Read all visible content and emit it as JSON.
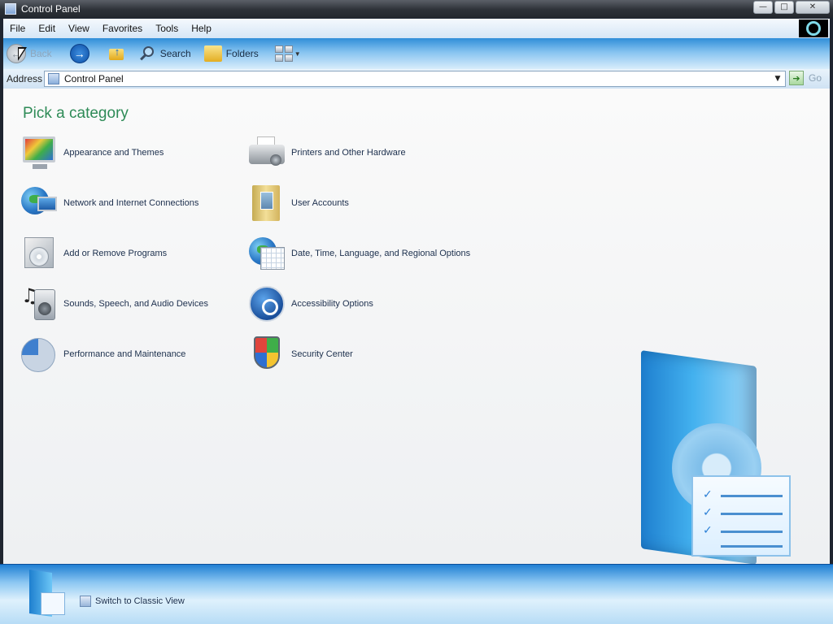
{
  "window": {
    "title": "Control Panel"
  },
  "menu": {
    "items": [
      "File",
      "Edit",
      "View",
      "Favorites",
      "Tools",
      "Help"
    ]
  },
  "toolbar": {
    "back_label": "Back",
    "search_label": "Search",
    "folders_label": "Folders"
  },
  "address": {
    "label": "Address",
    "value": "Control Panel",
    "go_label": "Go"
  },
  "content": {
    "heading": "Pick a category",
    "categories": [
      {
        "label": "Appearance and Themes",
        "icon": "appearance-themes-icon"
      },
      {
        "label": "Network and Internet Connections",
        "icon": "network-connections-icon"
      },
      {
        "label": "Add or Remove Programs",
        "icon": "add-remove-programs-icon"
      },
      {
        "label": "Sounds, Speech, and Audio Devices",
        "icon": "sounds-audio-icon"
      },
      {
        "label": "Performance and Maintenance",
        "icon": "performance-maintenance-icon"
      },
      {
        "label": "Printers and Other Hardware",
        "icon": "printers-hardware-icon"
      },
      {
        "label": "User Accounts",
        "icon": "user-accounts-icon"
      },
      {
        "label": "Date, Time, Language, and Regional Options",
        "icon": "date-time-regional-icon"
      },
      {
        "label": "Accessibility Options",
        "icon": "accessibility-icon"
      },
      {
        "label": "Security Center",
        "icon": "security-shield-icon"
      }
    ]
  },
  "footer": {
    "switch_label": "Switch to Classic View"
  }
}
